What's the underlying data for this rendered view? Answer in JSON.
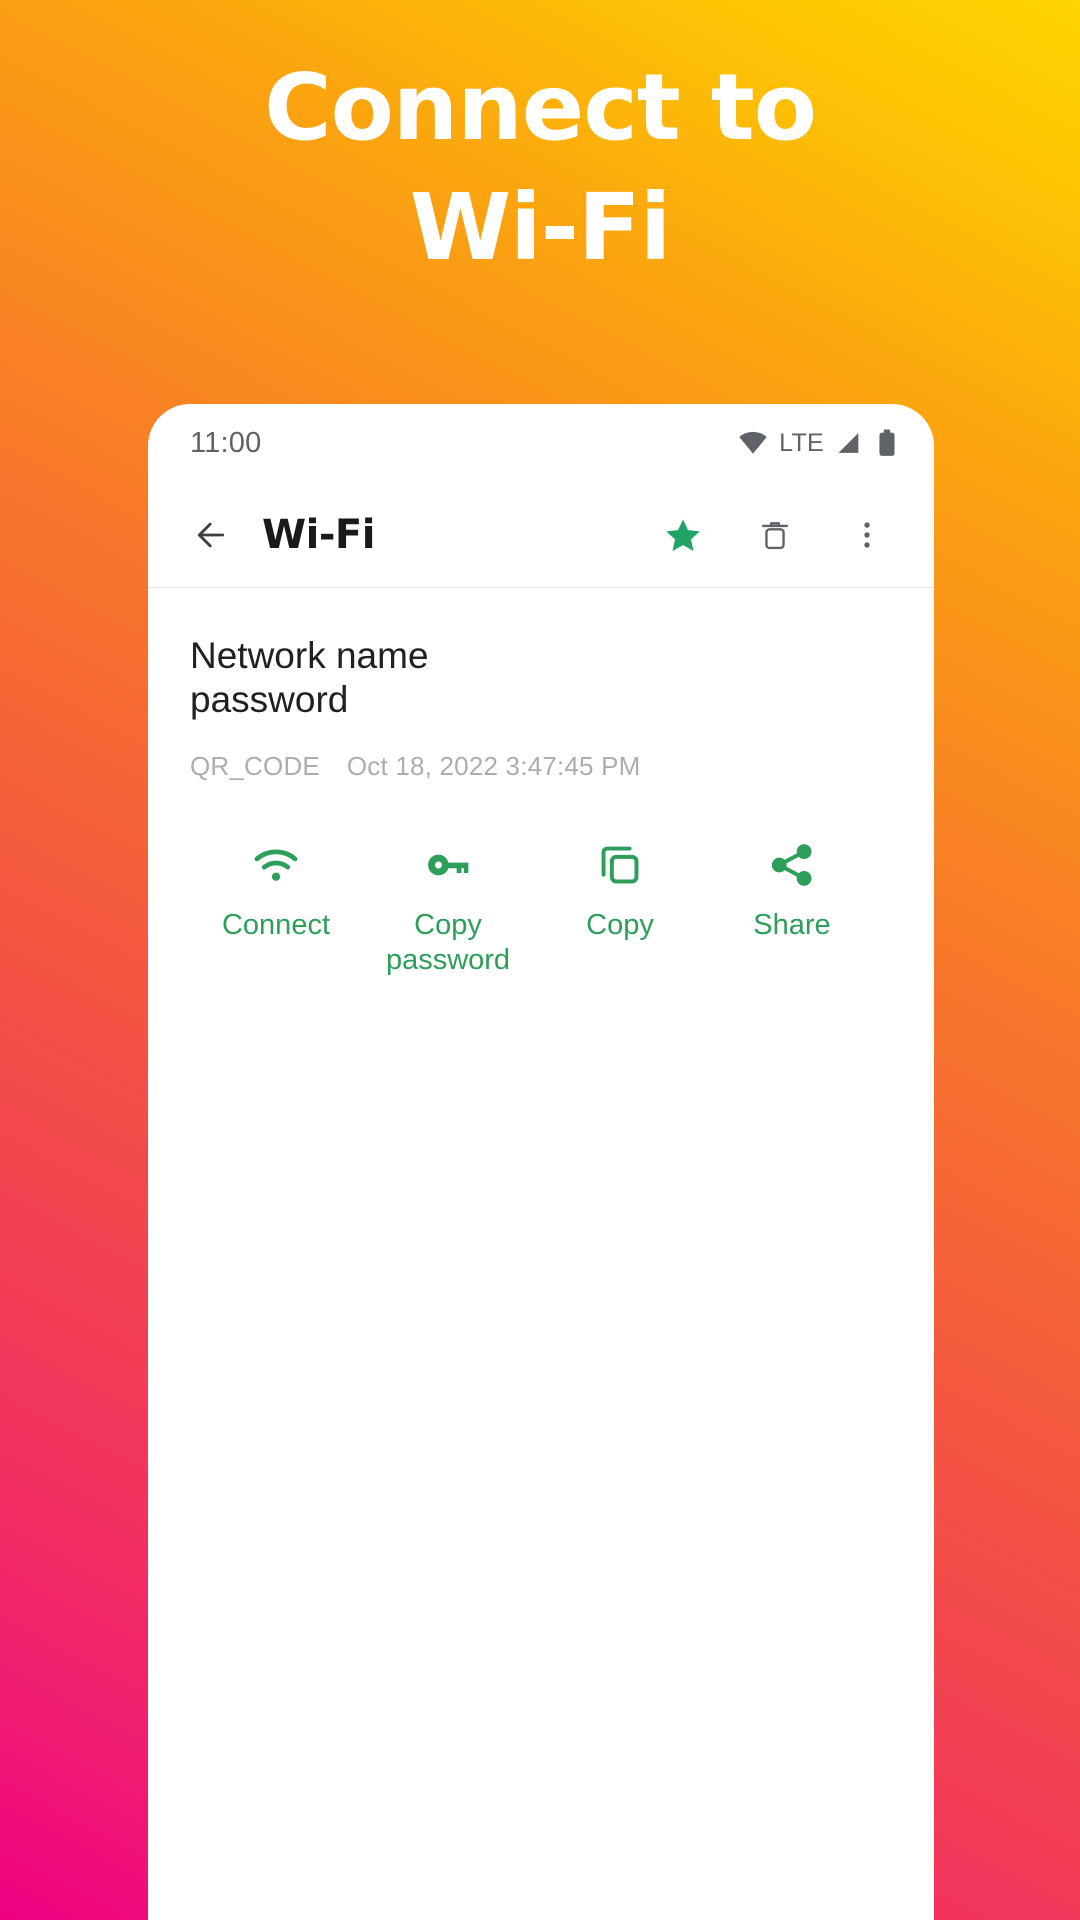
{
  "promo": {
    "headline_line1": "Connect to",
    "headline_line2": "Wi-Fi",
    "text_color": "#ffffff",
    "background_start": "#ED0080",
    "background_end": "#FFD400"
  },
  "phone": {
    "status_bar": {
      "time": "11:00",
      "network_label": "LTE",
      "icons": [
        "wifi-icon",
        "signal-icon",
        "battery-icon"
      ],
      "text_color": "#5f6368"
    },
    "app_bar": {
      "back_icon": "arrow-back-icon",
      "title": "Wi-Fi",
      "actions": [
        {
          "name": "favorite-star-button",
          "icon": "star-filled-icon",
          "color": "#21A366"
        },
        {
          "name": "delete-button",
          "icon": "trash-icon",
          "color": "#5f6368"
        },
        {
          "name": "overflow-menu-button",
          "icon": "more-vert-icon",
          "color": "#5f6368"
        }
      ]
    },
    "detail": {
      "network_name": "Network name",
      "password": "password",
      "type_label": "QR_CODE",
      "timestamp": "Oct 18, 2022 3:47:45 PM",
      "meta_color": "#adadad"
    },
    "actions": [
      {
        "name": "connect-action",
        "icon": "wifi-icon",
        "label": "Connect"
      },
      {
        "name": "copy-password-action",
        "icon": "key-icon",
        "label": "Copy password"
      },
      {
        "name": "copy-action",
        "icon": "copy-icon",
        "label": "Copy"
      },
      {
        "name": "share-action",
        "icon": "share-icon",
        "label": "Share"
      }
    ],
    "accent_color": "#2E9E5B"
  }
}
